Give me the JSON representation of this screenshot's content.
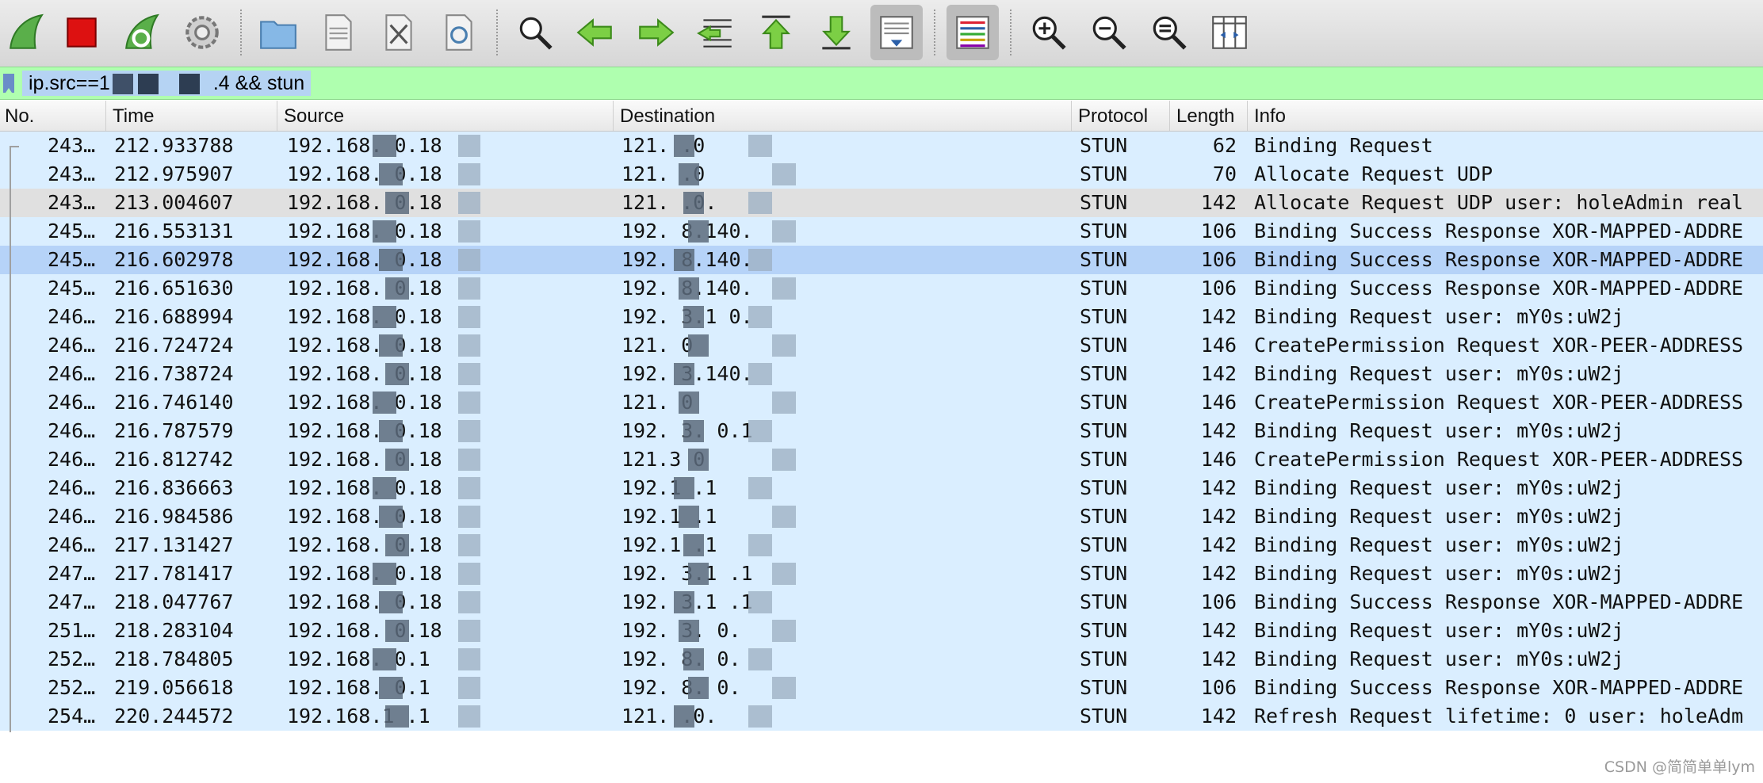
{
  "toolbar": {
    "buttons": [
      {
        "name": "start-capture-icon"
      },
      {
        "name": "stop-capture-icon"
      },
      {
        "name": "restart-capture-icon"
      },
      {
        "name": "capture-options-icon"
      },
      {
        "name": "open-file-icon"
      },
      {
        "name": "save-file-icon"
      },
      {
        "name": "close-file-icon"
      },
      {
        "name": "reload-file-icon"
      },
      {
        "name": "find-packet-icon"
      },
      {
        "name": "go-back-icon"
      },
      {
        "name": "go-forward-icon"
      },
      {
        "name": "go-to-packet-icon"
      },
      {
        "name": "go-first-packet-icon"
      },
      {
        "name": "go-last-packet-icon"
      },
      {
        "name": "auto-scroll-icon"
      },
      {
        "name": "colorize-icon"
      },
      {
        "name": "zoom-in-icon"
      },
      {
        "name": "zoom-out-icon"
      },
      {
        "name": "normal-size-icon"
      },
      {
        "name": "resize-columns-icon"
      }
    ]
  },
  "filter": {
    "prefix": "ip.src==1",
    "middle": ".4",
    "suffix": " && stun"
  },
  "columns": {
    "no": "No.",
    "time": "Time",
    "source": "Source",
    "destination": "Destination",
    "protocol": "Protocol",
    "length": "Length",
    "info": "Info"
  },
  "packets": [
    {
      "no": "243…",
      "time": "212.933788",
      "src": "192.168.  0.18",
      "dst": "121.  .0",
      "proto": "STUN",
      "len": "62",
      "info": "Binding Request"
    },
    {
      "no": "243…",
      "time": "212.975907",
      "src": "192.168.  0.18",
      "dst": "121.  .0",
      "proto": "STUN",
      "len": "70",
      "info": "Allocate Request UDP"
    },
    {
      "no": "243…",
      "time": "213.004607",
      "src": "192.168.  0.18",
      "dst": "121.  .0.",
      "proto": "STUN",
      "len": "142",
      "info": "Allocate Request UDP user: holeAdmin real"
    },
    {
      "no": "245…",
      "time": "216.553131",
      "src": "192.168.  0.18",
      "dst": "192.  8.140.",
      "proto": "STUN",
      "len": "106",
      "info": "Binding Success Response XOR-MAPPED-ADDRE"
    },
    {
      "no": "245…",
      "time": "216.602978",
      "src": "192.168.  0.18",
      "dst": "192.  8.140.",
      "proto": "STUN",
      "len": "106",
      "info": "Binding Success Response XOR-MAPPED-ADDRE"
    },
    {
      "no": "245…",
      "time": "216.651630",
      "src": "192.168.  0.18",
      "dst": "192.  8.140.",
      "proto": "STUN",
      "len": "106",
      "info": "Binding Success Response XOR-MAPPED-ADDRE"
    },
    {
      "no": "246…",
      "time": "216.688994",
      "src": "192.168.  0.18",
      "dst": "192.  3.1 0.",
      "proto": "STUN",
      "len": "142",
      "info": "Binding Request user: mY0s:uW2j"
    },
    {
      "no": "246…",
      "time": "216.724724",
      "src": "192.168.  0.18",
      "dst": "121.  0",
      "proto": "STUN",
      "len": "146",
      "info": "CreatePermission Request XOR-PEER-ADDRESS"
    },
    {
      "no": "246…",
      "time": "216.738724",
      "src": "192.168.  0.18",
      "dst": "192.  3.140.",
      "proto": "STUN",
      "len": "142",
      "info": "Binding Request user: mY0s:uW2j"
    },
    {
      "no": "246…",
      "time": "216.746140",
      "src": "192.168.  0.18",
      "dst": "121.  0",
      "proto": "STUN",
      "len": "146",
      "info": "CreatePermission Request XOR-PEER-ADDRESS"
    },
    {
      "no": "246…",
      "time": "216.787579",
      "src": "192.168.  0.18",
      "dst": "192.  3.  0.1",
      "proto": "STUN",
      "len": "142",
      "info": "Binding Request user: mY0s:uW2j"
    },
    {
      "no": "246…",
      "time": "216.812742",
      "src": "192.168.  0.18",
      "dst": "121.3  0",
      "proto": "STUN",
      "len": "146",
      "info": "CreatePermission Request XOR-PEER-ADDRESS"
    },
    {
      "no": "246…",
      "time": "216.836663",
      "src": "192.168.  0.18",
      "dst": "192.1    .1",
      "proto": "STUN",
      "len": "142",
      "info": "Binding Request user: mY0s:uW2j"
    },
    {
      "no": "246…",
      "time": "216.984586",
      "src": "192.168.  0.18",
      "dst": "192.1    .1",
      "proto": "STUN",
      "len": "142",
      "info": "Binding Request user: mY0s:uW2j"
    },
    {
      "no": "246…",
      "time": "217.131427",
      "src": "192.168.  0.18",
      "dst": "192.1    .1",
      "proto": "STUN",
      "len": "142",
      "info": "Binding Request user: mY0s:uW2j"
    },
    {
      "no": "247…",
      "time": "217.781417",
      "src": "192.168.  0.18",
      "dst": "192.  3.1  .1",
      "proto": "STUN",
      "len": "142",
      "info": "Binding Request user: mY0s:uW2j"
    },
    {
      "no": "247…",
      "time": "218.047767",
      "src": "192.168.  0.18",
      "dst": "192.  3.1  .1",
      "proto": "STUN",
      "len": "106",
      "info": "Binding Success Response XOR-MAPPED-ADDRE"
    },
    {
      "no": "251…",
      "time": "218.283104",
      "src": "192.168.  0.18",
      "dst": "192.  3.  0.",
      "proto": "STUN",
      "len": "142",
      "info": "Binding Request user: mY0s:uW2j"
    },
    {
      "no": "252…",
      "time": "218.784805",
      "src": "192.168.  0.1",
      "dst": "192.  8.  0.",
      "proto": "STUN",
      "len": "142",
      "info": "Binding Request user: mY0s:uW2j"
    },
    {
      "no": "252…",
      "time": "219.056618",
      "src": "192.168.  0.1",
      "dst": "192.  8.  0.",
      "proto": "STUN",
      "len": "106",
      "info": "Binding Success Response XOR-MAPPED-ADDRE"
    },
    {
      "no": "254…",
      "time": "220.244572",
      "src": "192.168.1  .1",
      "dst": "121.  .0.",
      "proto": "STUN",
      "len": "142",
      "info": "Refresh Request lifetime: 0 user: holeAdm"
    }
  ],
  "row_styles": {
    "selected_index": 4,
    "grey_index": 2,
    "colors": {
      "row": "#daeeff",
      "selected": "#b6d3f8",
      "grey": "#e0e0e0"
    }
  },
  "watermark": "CSDN @简简单单lym"
}
